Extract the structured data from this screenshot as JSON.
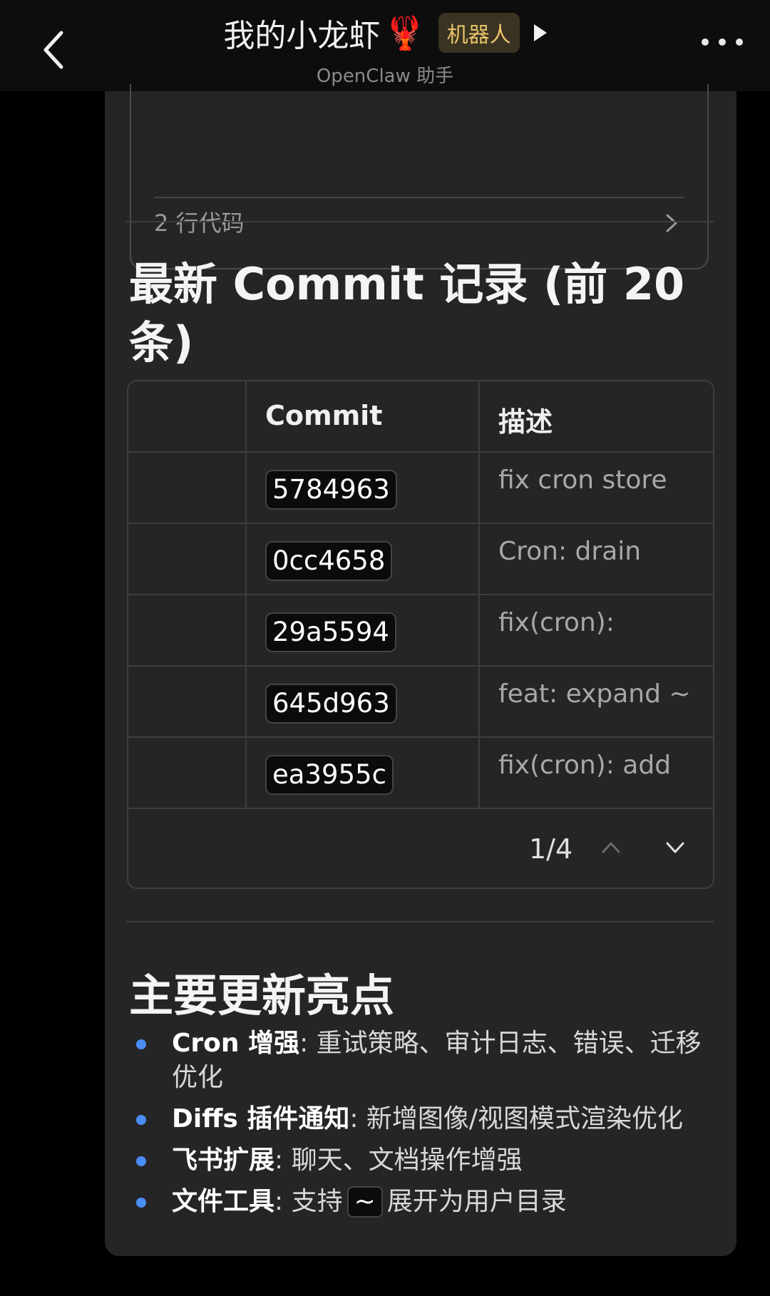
{
  "header": {
    "title": "我的小龙虾",
    "emoji": "🦞",
    "badge": "机器人",
    "subtitle": "OpenClaw 助手"
  },
  "code_card": {
    "lines_label": "2 行代码"
  },
  "commit_section": {
    "heading": "最新 Commit 记录 (前 20 条)",
    "table": {
      "headers": [
        "",
        "Commit",
        "描述"
      ],
      "rows": [
        {
          "commit": "5784963",
          "desc": "fix cron store"
        },
        {
          "commit": "0cc4658",
          "desc": "Cron: drain"
        },
        {
          "commit": "29a5594",
          "desc": "fix(cron):"
        },
        {
          "commit": "645d963",
          "desc": "feat: expand ~"
        },
        {
          "commit": "ea3955c",
          "desc": "fix(cron): add"
        }
      ],
      "pagination": "1/4"
    }
  },
  "highlights": {
    "heading": "主要更新亮点",
    "items": [
      {
        "title": "Cron 增强",
        "text": ": 重试策略、审计日志、错误、迁移优化"
      },
      {
        "title": "Diffs 插件通知",
        "text": ": 新增图像/视图模式渲染优化"
      },
      {
        "title": "飞书扩展",
        "text": ": 聊天、文档操作增强"
      },
      {
        "title": "文件工具",
        "text_before": ": 支持",
        "code": "~",
        "text_after": "展开为用户目录"
      }
    ]
  },
  "colors": {
    "background": "#000000",
    "bubble": "#252526",
    "badge_text": "#e8c26a",
    "bullet_dot": "#4a8df6"
  }
}
